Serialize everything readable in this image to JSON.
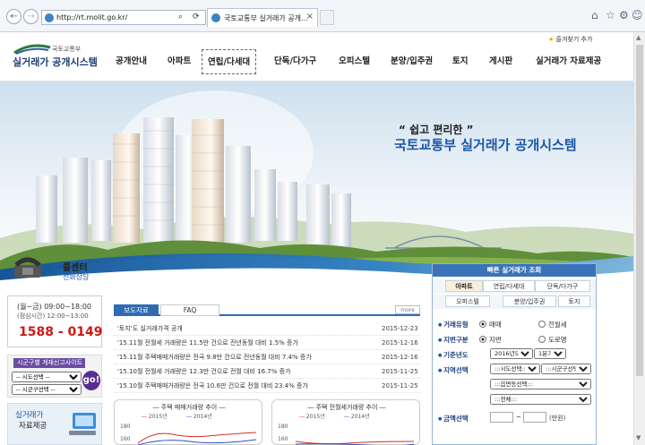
{
  "browser": {
    "url": "http://rt.molit.go.kr/",
    "tab_title": "국토교통부 실거래가 공개...",
    "nav_back": "←",
    "nav_forward": "→",
    "search_glyph": "⌕",
    "refresh_glyph": "⟳",
    "tab_close": "×",
    "home_glyph": "⌂",
    "favorites_glyph": "☆",
    "settings_glyph": "⚙",
    "smiley_glyph": "☺",
    "scroll_up": "▲",
    "scroll_down": "▼"
  },
  "header": {
    "ministry": "국토교통부",
    "system_name": "실거래가 공개시스템",
    "favorite_label": "즐겨찾기 추가",
    "menu": [
      "공개안내",
      "아파트",
      "연립/다세대",
      "단독/다가구",
      "오피스텔",
      "분양/입주권",
      "토지",
      "게시판",
      "실거래가 자료제공"
    ],
    "active_menu_index": 2
  },
  "hero": {
    "slogan_small": "“ 쉽고 편리한 ”",
    "slogan_big": "국토교통부 실거래가 공개시스템"
  },
  "callcenter": {
    "title": "콜센터",
    "subtitle": "전화상담",
    "hours": "(월~금) 09:00~18:00",
    "lunch": "(점심시간) 12:00~13:00",
    "phone": "1588 - 0149"
  },
  "sido_links": {
    "title": "시군구별 게재신고사이트",
    "sido_placeholder": "-- 시도선택 --",
    "sigungu_placeholder": "-- 시군구선택 --",
    "go": "go!"
  },
  "data_banner": {
    "line1": "실거래가",
    "line2": "자료제공"
  },
  "news": {
    "tab_press": "보도자료",
    "tab_faq": "FAQ",
    "more": "more",
    "items": [
      {
        "title": "'토지'도 실거래가격 공개",
        "date": "2015-12-23"
      },
      {
        "title": "'15.11월 전월세 거래량은 11.5만 건으로 전년동월 대비 1.5% 증가",
        "date": "2015-12-16"
      },
      {
        "title": "'15.11월 주택매매거래량은 전국 9.8만 건으로 전년동월 대비 7.4% 증가",
        "date": "2015-12-16"
      },
      {
        "title": "'15.10월 전월세 거래량은 12.3만 건으로 전월 대비 16.7% 증가",
        "date": "2015-11-25"
      },
      {
        "title": "'15.10월 주택매매거래량은 전국 10.6만 건으로 전월 대비 23.4% 증가",
        "date": "2015-11-25"
      }
    ]
  },
  "charts": {
    "left_title": "주택 매매거래량 추이",
    "right_title": "주택 전월세거래량 추이",
    "legend_2015": "2015년",
    "legend_2014": "2014년",
    "y_top": "180",
    "y_mid": "160",
    "color_2015": "#d03030",
    "color_2014": "#3050c0"
  },
  "quick_search": {
    "title": "빠른 실거래가 조회",
    "types_row1": [
      "아파트",
      "연립/다세대",
      "단독/다가구"
    ],
    "types_row2": [
      "오피스텔",
      "분양/입주권",
      "토지"
    ],
    "active_type": "아파트",
    "deal_label": "거래유형",
    "deal_options": [
      "매매",
      "전월세"
    ],
    "deal_selected": "매매",
    "addr_label": "지번구분",
    "addr_options": [
      "지번",
      "도로명"
    ],
    "addr_selected": "지번",
    "year_label": "기준년도",
    "year_value": "2016년도",
    "quarter_value": "1분기",
    "region_label": "지역선택",
    "sido_value": ":::시도선택:::",
    "sigungu_value": ":::시군구선택:::",
    "dong_value": ":::읍면동선택:::",
    "all_value": ":::전체:::",
    "amount_label": "금액선택",
    "tilde": "~",
    "unit": "(만원)"
  }
}
